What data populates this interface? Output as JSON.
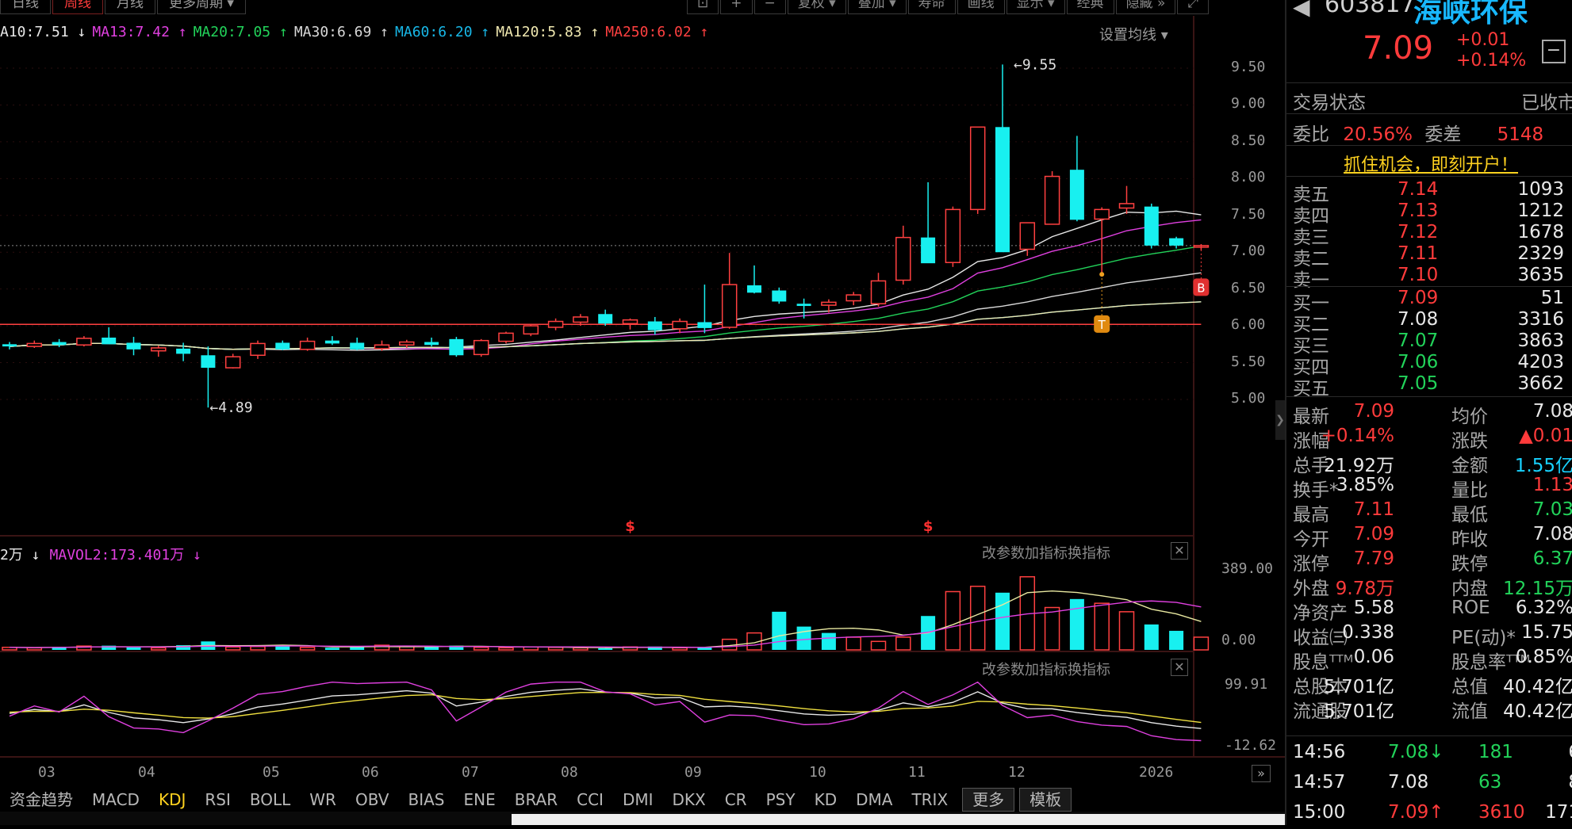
{
  "toolbar": {
    "tabs": [
      {
        "label": "日线",
        "active": false
      },
      {
        "label": "周线",
        "active": true
      },
      {
        "label": "月线",
        "active": false
      },
      {
        "label": "更多周期 ▾",
        "active": false
      }
    ],
    "right_buttons": [
      "⊡",
      "+",
      "−",
      "复权 ▾",
      "叠加 ▾",
      "寿命",
      "画线",
      "显示 ▾",
      "经典",
      "隐藏 »",
      "⤢"
    ]
  },
  "ma_legend": {
    "items": [
      {
        "text": "A10:7.51 ↓",
        "color": "#e8e8e8"
      },
      {
        "text": "MA13:7.42 ↑",
        "color": "#e040e0"
      },
      {
        "text": "MA20:7.05 ↑",
        "color": "#22d35a"
      },
      {
        "text": "MA30:6.69 ↑",
        "color": "#d8d8d8"
      },
      {
        "text": "MA60:6.20 ↑",
        "color": "#18b8e8"
      },
      {
        "text": "MA120:5.83 ↑",
        "color": "#f0e8b0"
      },
      {
        "text": "MA250:6.02 ↑",
        "color": "#ff4040"
      }
    ],
    "settings": "设置均线 ▾"
  },
  "price_axis": [
    "9.50",
    "9.00",
    "8.50",
    "8.00",
    "7.50",
    "7.00",
    "6.50",
    "6.00",
    "5.50",
    "5.00"
  ],
  "annotations": {
    "high": "9.55",
    "low": "4.89",
    "buy_marker": "B",
    "t_marker": "T",
    "s_marker": "$"
  },
  "volume_pane": {
    "legend": [
      {
        "text": "2万 ↓",
        "color": "#e8e8e8"
      },
      {
        "text": "MAVOL2:173.401万 ↓",
        "color": "#e040e0"
      }
    ],
    "axis": [
      "389.00",
      "0.00"
    ],
    "buttons": [
      "改参数",
      "加指标",
      "换指标"
    ],
    "close": "✕"
  },
  "kdj_pane": {
    "axis": [
      "99.91",
      "-12.62"
    ],
    "buttons": [
      "改参数",
      "加指标",
      "换指标"
    ],
    "close": "✕"
  },
  "x_axis": [
    "03",
    "04",
    "05",
    "06",
    "07",
    "08",
    "09",
    "10",
    "11",
    "12",
    "2026"
  ],
  "indicator_tabs": [
    {
      "label": "资金趋势",
      "active": false
    },
    {
      "label": "MACD",
      "active": false
    },
    {
      "label": "KDJ",
      "active": true
    },
    {
      "label": "RSI",
      "active": false
    },
    {
      "label": "BOLL",
      "active": false
    },
    {
      "label": "WR",
      "active": false
    },
    {
      "label": "OBV",
      "active": false
    },
    {
      "label": "BIAS",
      "active": false
    },
    {
      "label": "ENE",
      "active": false
    },
    {
      "label": "BRAR",
      "active": false
    },
    {
      "label": "CCI",
      "active": false
    },
    {
      "label": "DMI",
      "active": false
    },
    {
      "label": "DKX",
      "active": false
    },
    {
      "label": "CR",
      "active": false
    },
    {
      "label": "PSY",
      "active": false
    },
    {
      "label": "KD",
      "active": false
    },
    {
      "label": "DMA",
      "active": false
    },
    {
      "label": "TRIX",
      "active": false
    },
    {
      "label": "更多",
      "active": false,
      "boxed": true
    },
    {
      "label": "模板",
      "active": false,
      "boxed": true
    }
  ],
  "chart_data": {
    "type": "candlestick",
    "candles": [
      [
        5.75,
        5.78,
        5.68,
        5.72
      ],
      [
        5.72,
        5.8,
        5.7,
        5.76
      ],
      [
        5.78,
        5.82,
        5.71,
        5.74
      ],
      [
        5.74,
        5.86,
        5.72,
        5.83
      ],
      [
        5.84,
        5.98,
        5.8,
        5.75
      ],
      [
        5.77,
        5.85,
        5.6,
        5.68
      ],
      [
        5.66,
        5.73,
        5.58,
        5.7
      ],
      [
        5.69,
        5.77,
        5.52,
        5.62
      ],
      [
        5.6,
        5.72,
        4.89,
        5.43
      ],
      [
        5.43,
        5.62,
        5.42,
        5.58
      ],
      [
        5.6,
        5.8,
        5.55,
        5.76
      ],
      [
        5.77,
        5.8,
        5.67,
        5.68
      ],
      [
        5.68,
        5.84,
        5.66,
        5.79
      ],
      [
        5.8,
        5.86,
        5.74,
        5.76
      ],
      [
        5.77,
        5.84,
        5.67,
        5.68
      ],
      [
        5.69,
        5.8,
        5.66,
        5.74
      ],
      [
        5.74,
        5.81,
        5.7,
        5.78
      ],
      [
        5.78,
        5.84,
        5.72,
        5.74
      ],
      [
        5.82,
        5.85,
        5.58,
        5.6
      ],
      [
        5.61,
        5.82,
        5.58,
        5.8
      ],
      [
        5.79,
        5.92,
        5.76,
        5.9
      ],
      [
        5.89,
        6.02,
        5.86,
        6.0
      ],
      [
        5.98,
        6.1,
        5.94,
        6.06
      ],
      [
        6.05,
        6.16,
        6.0,
        6.12
      ],
      [
        6.16,
        6.22,
        6.0,
        6.03
      ],
      [
        6.03,
        6.1,
        5.95,
        6.08
      ],
      [
        6.06,
        6.12,
        5.88,
        5.94
      ],
      [
        5.96,
        6.1,
        5.9,
        6.06
      ],
      [
        6.05,
        6.56,
        5.9,
        5.97
      ],
      [
        5.98,
        6.99,
        5.96,
        6.56
      ],
      [
        6.55,
        6.82,
        6.44,
        6.45
      ],
      [
        6.48,
        6.52,
        6.3,
        6.33
      ],
      [
        6.3,
        6.37,
        6.1,
        6.27
      ],
      [
        6.28,
        6.36,
        6.18,
        6.32
      ],
      [
        6.34,
        6.46,
        6.28,
        6.42
      ],
      [
        6.3,
        6.72,
        6.26,
        6.61
      ],
      [
        6.62,
        7.36,
        6.56,
        7.2
      ],
      [
        7.2,
        7.95,
        6.97,
        6.85
      ],
      [
        6.86,
        7.62,
        6.8,
        7.58
      ],
      [
        7.58,
        8.3,
        7.52,
        8.7
      ],
      [
        8.7,
        9.55,
        7.02,
        7.0
      ],
      [
        7.04,
        7.4,
        6.95,
        7.4
      ],
      [
        7.38,
        8.1,
        7.38,
        8.03
      ],
      [
        8.12,
        8.58,
        7.42,
        7.44
      ],
      [
        7.45,
        7.61,
        6.7,
        7.58
      ],
      [
        7.6,
        7.9,
        7.52,
        7.66
      ],
      [
        7.62,
        7.66,
        7.05,
        7.09
      ],
      [
        7.19,
        7.21,
        7.05,
        7.09
      ],
      [
        7.08,
        7.11,
        7.03,
        7.09
      ]
    ],
    "volumes": [
      12,
      10,
      14,
      18,
      20,
      12,
      10,
      22,
      40,
      14,
      16,
      20,
      12,
      10,
      14,
      22,
      16,
      14,
      20,
      12,
      10,
      14,
      12,
      10,
      8,
      14,
      16,
      10,
      12,
      50,
      80,
      180,
      110,
      80,
      60,
      40,
      60,
      160,
      275,
      300,
      270,
      345,
      200,
      240,
      220,
      180,
      120,
      90,
      60,
      20
    ],
    "volume_up": [
      1,
      1,
      0,
      1,
      0,
      0,
      1,
      0,
      0,
      1,
      1,
      0,
      1,
      0,
      0,
      1,
      1,
      0,
      0,
      1,
      1,
      1,
      1,
      1,
      0,
      1,
      0,
      1,
      0,
      1,
      1,
      0,
      0,
      0,
      1,
      1,
      1,
      0,
      1,
      1,
      0,
      1,
      1,
      0,
      1,
      1,
      0,
      0,
      1,
      0
    ]
  }
}
